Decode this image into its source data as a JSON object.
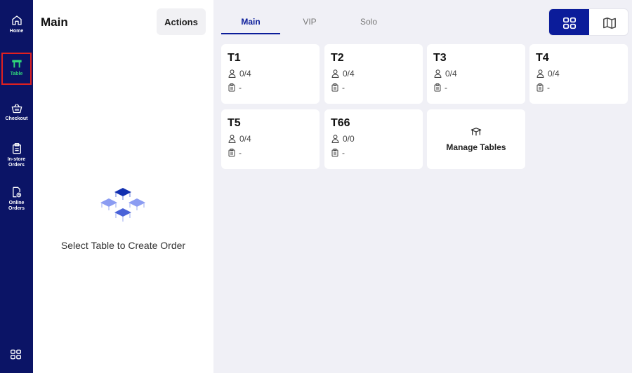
{
  "sidebar": {
    "items": [
      {
        "label": "Home",
        "icon": "home-icon"
      },
      {
        "label": "Table",
        "icon": "table-icon",
        "active": true
      },
      {
        "label": "Checkout",
        "icon": "basket-icon"
      },
      {
        "label": "In-store\nOrders",
        "icon": "clipboard-icon"
      },
      {
        "label": "Online\nOrders",
        "icon": "online-orders-icon"
      }
    ],
    "bottom_icon": "grid-icon"
  },
  "left_panel": {
    "title": "Main",
    "actions_label": "Actions",
    "empty_message": "Select Table to Create Order"
  },
  "tabs": [
    {
      "label": "Main",
      "active": true
    },
    {
      "label": "VIP"
    },
    {
      "label": "Solo"
    }
  ],
  "view_toggle": {
    "active": "grid"
  },
  "tables": [
    {
      "name": "T1",
      "guests": "0/4",
      "order": "-"
    },
    {
      "name": "T2",
      "guests": "0/4",
      "order": "-"
    },
    {
      "name": "T3",
      "guests": "0/4",
      "order": "-"
    },
    {
      "name": "T4",
      "guests": "0/4",
      "order": "-"
    },
    {
      "name": "T5",
      "guests": "0/4",
      "order": "-"
    },
    {
      "name": "T66",
      "guests": "0/0",
      "order": "-"
    }
  ],
  "manage_tables_label": "Manage Tables",
  "colors": {
    "sidebar_bg": "#0b1466",
    "accent": "#0b1c9a",
    "active_nav_text": "#2fd47a",
    "active_outline": "#e02020"
  }
}
